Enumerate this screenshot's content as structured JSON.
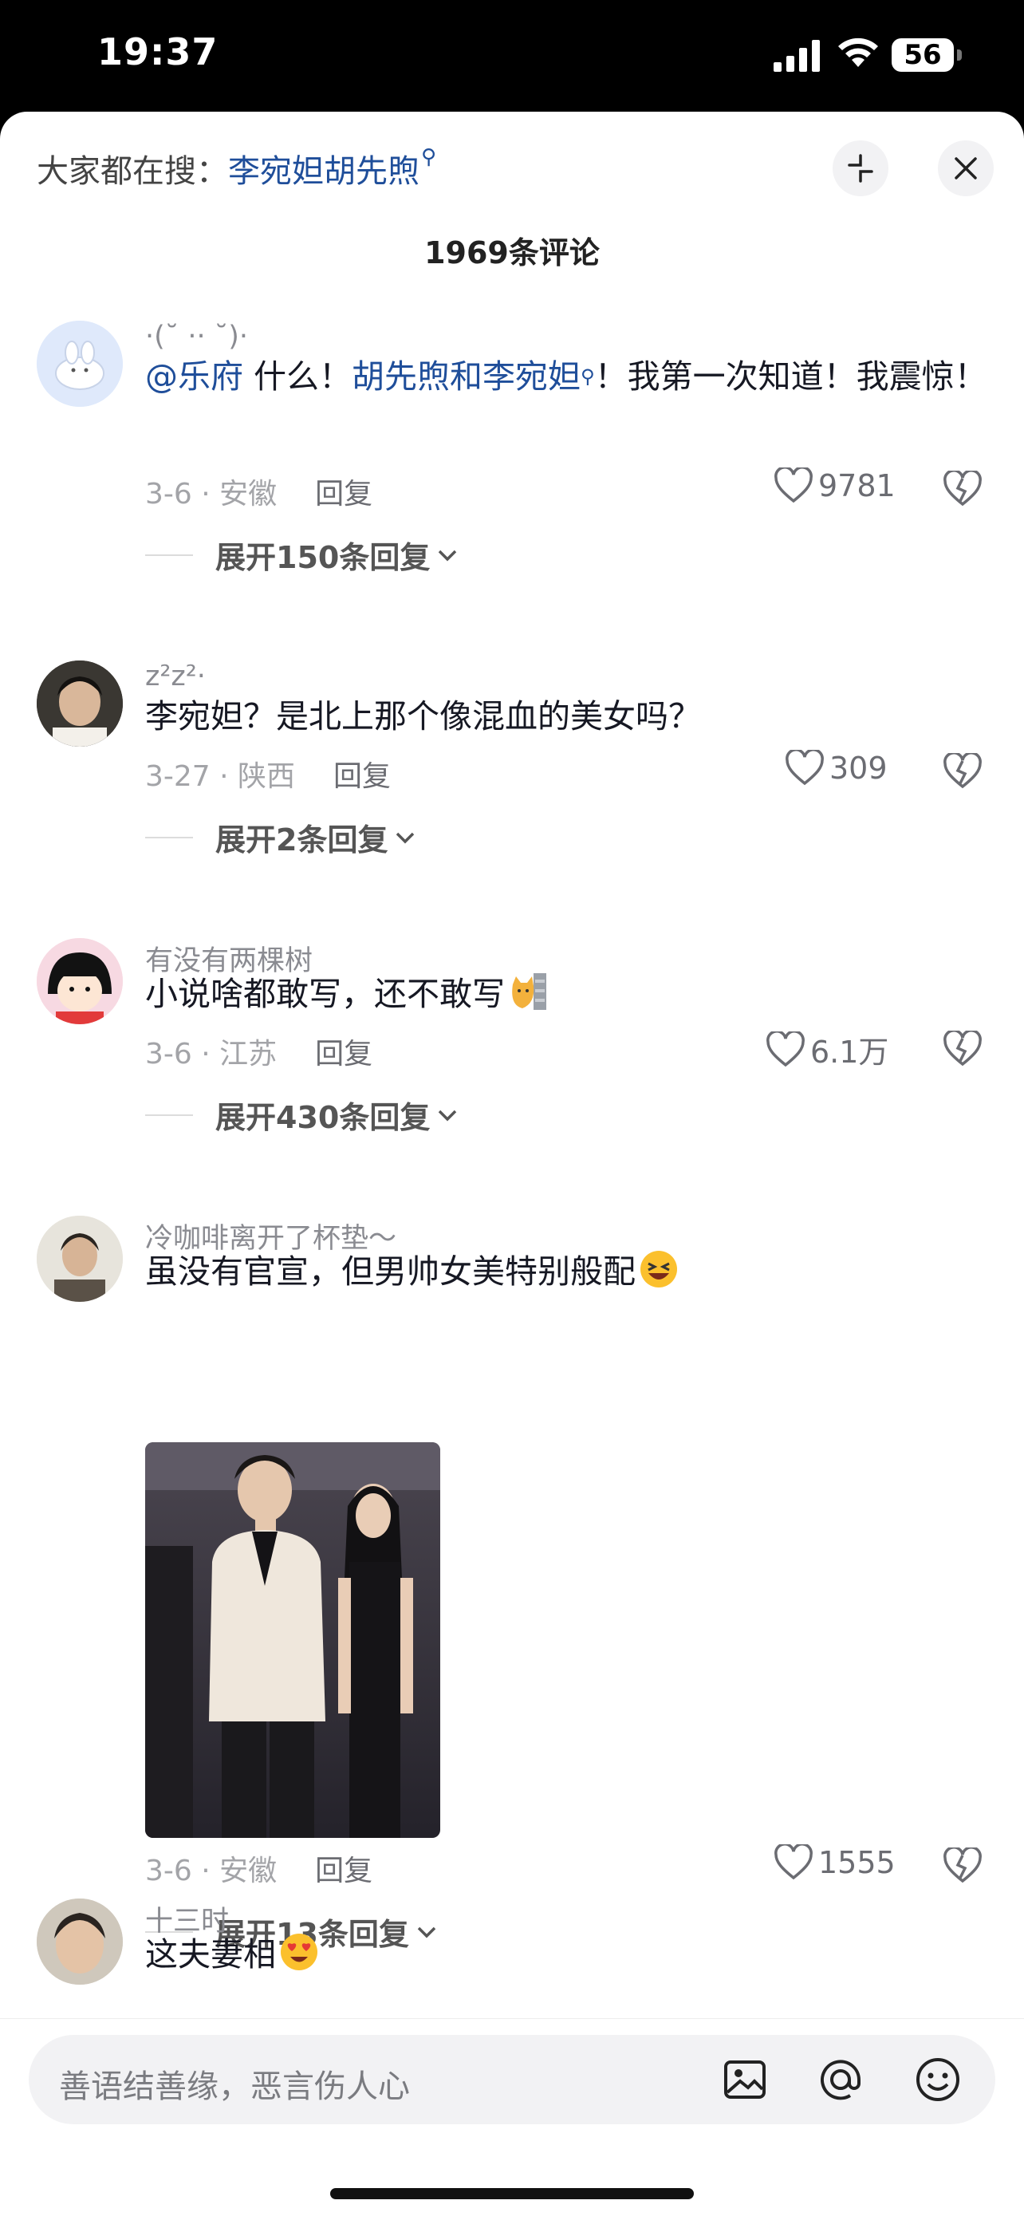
{
  "status_bar": {
    "time": "19:37",
    "battery": "56"
  },
  "header": {
    "hot_search_prefix": "大家都在搜：",
    "hot_search_term": "李宛妲胡先煦",
    "comment_count": "1969条评论"
  },
  "comments": [
    {
      "username": "·(˘ ·· ˘)·",
      "mention": "@乐府",
      "text_a": " 什么！",
      "link": "胡先煦和李宛妲",
      "text_b": "！我第一次知道！我震惊！",
      "date_loc": "3-6 · 安徽",
      "reply": "回复",
      "likes": "9781",
      "expand": "展开150条回复"
    },
    {
      "username": "z²z²·",
      "text": "李宛妲？是北上那个像混血的美女吗？",
      "date_loc": "3-27 · 陕西",
      "reply": "回复",
      "likes": "309",
      "expand": "展开2条回复"
    },
    {
      "username": "有没有两棵树",
      "text": "小说啥都敢写，还不敢写",
      "date_loc": "3-6 · 江苏",
      "reply": "回复",
      "likes": "6.1万",
      "expand": "展开430条回复"
    },
    {
      "username": "冷咖啡离开了杯垫～",
      "text": "虽没有官宣，但男帅女美特别般配",
      "date_loc": "3-6 · 安徽",
      "reply": "回复",
      "likes": "1555",
      "expand": "展开13条回复"
    },
    {
      "username": "十三时",
      "text": "这夫妻相"
    }
  ],
  "input": {
    "placeholder": "善语结善缘，恶言伤人心"
  },
  "icons": [
    "search-icon",
    "collapse-icon",
    "close-icon",
    "heart-icon",
    "broken-heart-icon",
    "chevron-down-icon",
    "image-icon",
    "at-icon",
    "emoji-icon"
  ]
}
